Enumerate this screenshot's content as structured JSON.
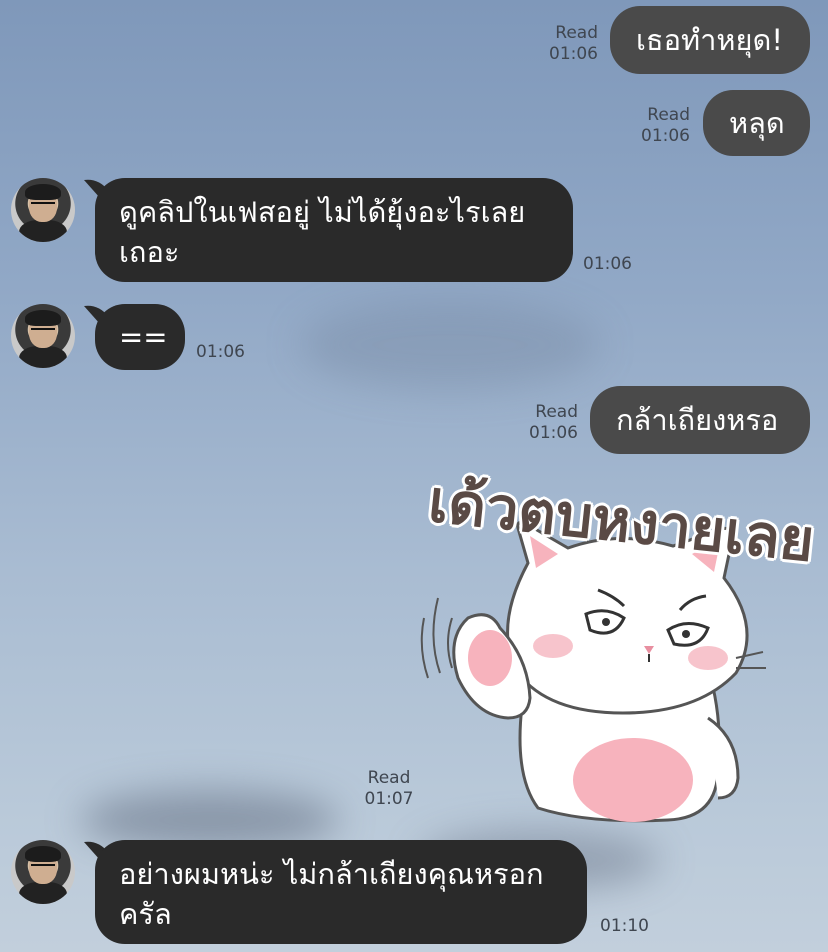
{
  "messages": [
    {
      "id": "m1",
      "side": "out",
      "text": "เธอทำหยุด!",
      "read": "Read",
      "time": "01:06"
    },
    {
      "id": "m2",
      "side": "out",
      "text": "หลุด",
      "read": "Read",
      "time": "01:06"
    },
    {
      "id": "m3",
      "side": "in",
      "text": "ดูคลิปในเฟสอยู่ ไม่ได้ยุ้งอะไรเลย\nเถอะ",
      "time": "01:06"
    },
    {
      "id": "m4",
      "side": "in",
      "text": "==",
      "time": "01:06"
    },
    {
      "id": "m5",
      "side": "out",
      "text": "กล้าเถียงหรอ",
      "read": "Read",
      "time": "01:06"
    },
    {
      "id": "m6",
      "side": "out",
      "type": "sticker",
      "sticker_text": "เด้วตบหงายเลย",
      "sticker_icon": "angry-cat-sticker",
      "read": "Read",
      "time": "01:07"
    },
    {
      "id": "m7",
      "side": "in",
      "text": "อย่างผมหน่ะ ไม่กล้าเถียงคุณหรอก\nครัล",
      "time": "01:10"
    }
  ],
  "colors": {
    "outgoing_bubble": "#4a4a4a",
    "incoming_bubble": "#2a2a2a",
    "meta_text": "#3f4650"
  }
}
